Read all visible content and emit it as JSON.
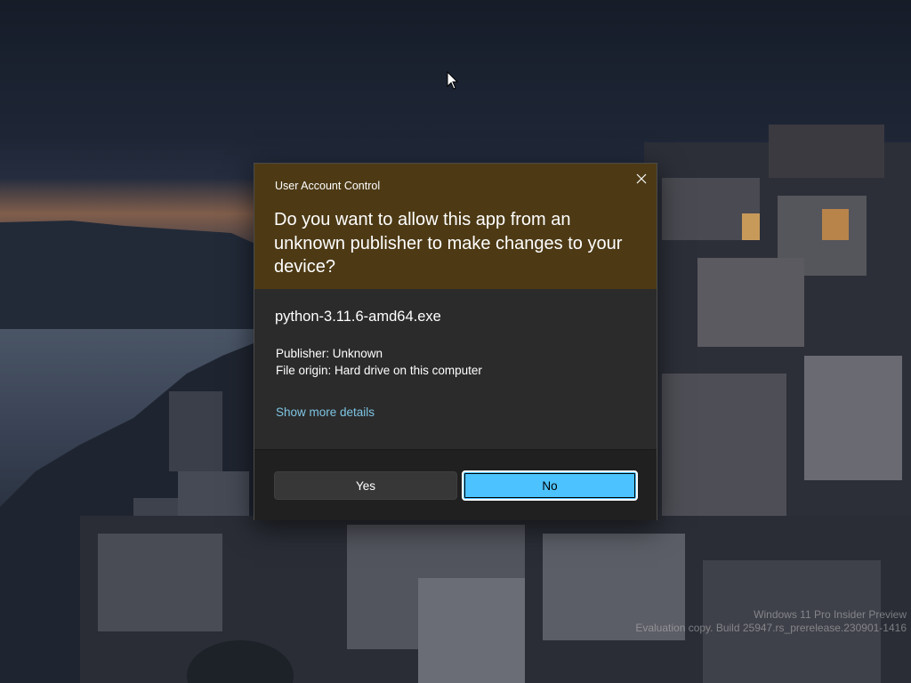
{
  "dialog": {
    "title": "User Account Control",
    "question": "Do you want to allow this app from an unknown publisher to make changes to your device?",
    "app_name": "python-3.11.6-amd64.exe",
    "publisher": "Publisher: Unknown",
    "file_origin": "File origin: Hard drive on this computer",
    "more_details_link": "Show more details",
    "yes_label": "Yes",
    "no_label": "No",
    "close_icon": "close-icon"
  },
  "watermark": {
    "line1": "Windows 11 Pro Insider Preview",
    "line2": "Evaluation copy. Build 25947.rs_prerelease.230901-1416"
  },
  "colors": {
    "header_bg": "#4d3a15",
    "body_bg": "#2b2b2b",
    "footer_bg": "#202020",
    "accent": "#4cc2ff",
    "link": "#7ec5e4"
  }
}
